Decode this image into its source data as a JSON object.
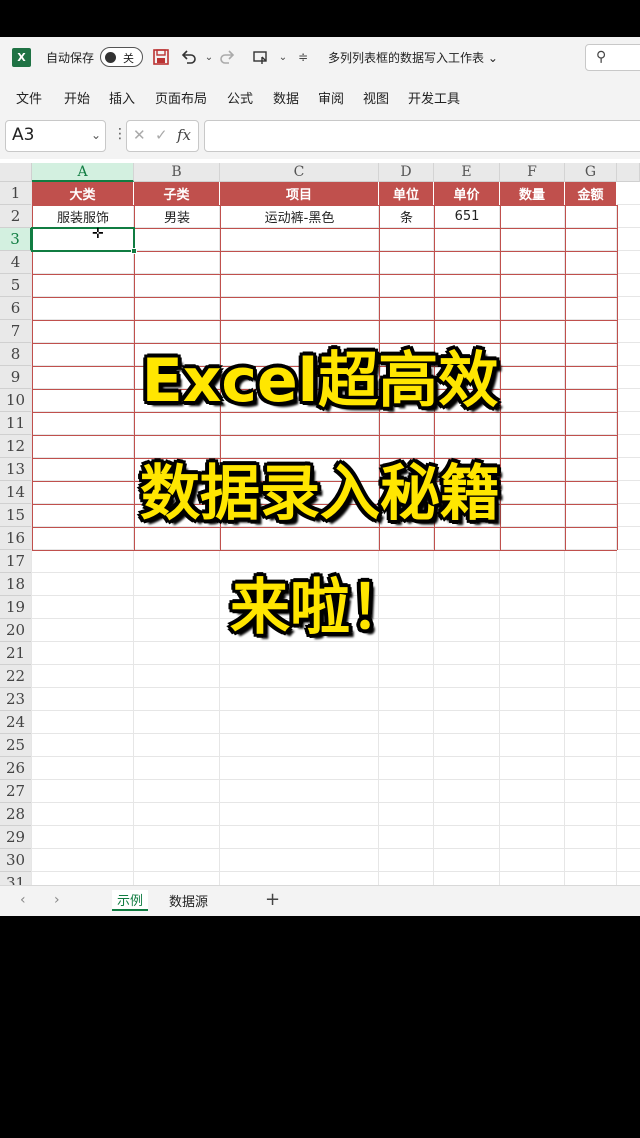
{
  "titlebar": {
    "app_icon": "X",
    "autosave_label": "自动保存",
    "autosave_state": "关",
    "doc_title": "多列列表框的数据写入工作表",
    "icons": [
      "save-icon",
      "undo-icon",
      "redo-icon",
      "touch-mode-icon",
      "customize-icon"
    ]
  },
  "menu": [
    "文件",
    "开始",
    "插入",
    "页面布局",
    "公式",
    "数据",
    "审阅",
    "视图",
    "开发工具"
  ],
  "formula_bar": {
    "name_box": "A3",
    "cancel": "✕",
    "enter": "✓",
    "fx": "fx",
    "value": ""
  },
  "columns": [
    "A",
    "B",
    "C",
    "D",
    "E",
    "F",
    "G"
  ],
  "rows": [
    "1",
    "2",
    "3",
    "4",
    "5",
    "6",
    "7",
    "8",
    "9",
    "10",
    "11",
    "12",
    "13",
    "14",
    "15",
    "16",
    "17",
    "18",
    "19",
    "20",
    "21",
    "22",
    "23",
    "24",
    "25",
    "26",
    "27",
    "28",
    "29",
    "30",
    "31"
  ],
  "table": {
    "headers": [
      "大类",
      "子类",
      "项目",
      "单位",
      "单价",
      "数量",
      "金额"
    ],
    "data": [
      [
        "服装服饰",
        "男装",
        "运动裤-黑色",
        "条",
        "651",
        "",
        ""
      ]
    ]
  },
  "active_cell": "A3",
  "overlay": {
    "line1": "Excel超高效",
    "line2": "数据录入秘籍",
    "line3": "来啦！"
  },
  "sheets": [
    {
      "name": "示例",
      "active": true
    },
    {
      "name": "数据源",
      "active": false
    }
  ],
  "colors": {
    "header_fill": "#c0504d",
    "excel_green": "#107c41",
    "headline_fill": "#ffe600"
  }
}
